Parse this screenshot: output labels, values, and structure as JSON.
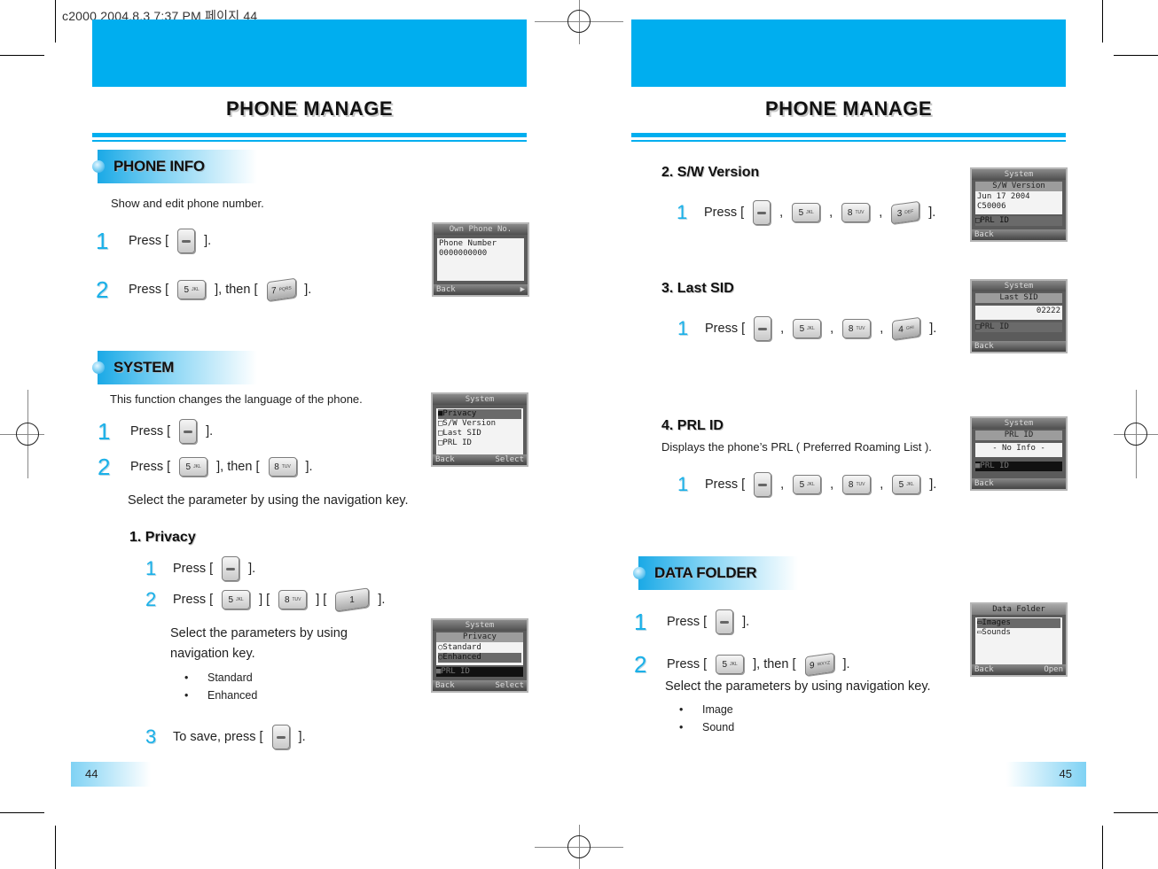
{
  "slug": "c2000  2004.8.3 7:37 PM 페이지 44",
  "colors": {
    "accent": "#00aeef",
    "step_number": "#1ab0e8"
  },
  "left_page": {
    "title": "PHONE MANAGE",
    "page_number": "44",
    "phone_info": {
      "heading": "PHONE INFO",
      "description": "Show and edit phone number.",
      "steps": [
        {
          "num": "1",
          "before": "Press [",
          "after": "]."
        },
        {
          "num": "2",
          "before": "Press [",
          "mid": "], then [",
          "after": "]."
        }
      ],
      "keys": {
        "k5": "5",
        "k5sub": "JKL",
        "k7": "7",
        "k7sub": "PQRS"
      },
      "screen": {
        "title": "Own Phone No.",
        "row1": "Phone Number",
        "row2": "0000000000",
        "left": "Back",
        "right": "▶"
      }
    },
    "system": {
      "heading": "SYSTEM",
      "description": "This function changes the language of the phone.",
      "steps": [
        {
          "num": "1",
          "before": "Press [",
          "after": "]."
        },
        {
          "num": "2",
          "before": "Press [",
          "mid": "], then [",
          "after": "]."
        }
      ],
      "keys": {
        "k5": "5",
        "k5sub": "JKL",
        "k8": "8",
        "k8sub": "TUV"
      },
      "instruction": "Select the parameter by using the navigation key.",
      "screen": {
        "title": "System",
        "items": [
          "Privacy",
          "S/W Version",
          "Last SID",
          "PRL ID"
        ],
        "left": "Back",
        "right": "Select"
      }
    },
    "privacy": {
      "heading": "1. Privacy",
      "steps": [
        {
          "num": "1",
          "before": "Press [",
          "after": "]."
        },
        {
          "num": "2",
          "before": "Press [",
          "sep1": "] [",
          "sep2": "] [",
          "after": "]."
        },
        {
          "num": "3",
          "before": "To save, press [",
          "after": "]."
        }
      ],
      "keys": {
        "k5": "5",
        "k5sub": "JKL",
        "k8": "8",
        "k8sub": "TUV",
        "k1": "1"
      },
      "instruction_line1": "Select the parameters by using",
      "instruction_line2": "navigation key.",
      "options": [
        "Standard",
        "Enhanced"
      ],
      "screen": {
        "title": "System",
        "sub": "Privacy",
        "items": [
          "Standard",
          "Enhanced"
        ],
        "bottom_item": "PRL ID",
        "left": "Back",
        "right": "Select"
      }
    }
  },
  "right_page": {
    "title": "PHONE MANAGE",
    "page_number": "45",
    "sw_version": {
      "heading": "2. S/W Version",
      "step": {
        "num": "1",
        "before": "Press [",
        "sep": ",",
        "after": "]."
      },
      "keys": [
        "5",
        "8",
        "3"
      ],
      "key_subs": [
        "JKL",
        "TUV",
        "DEF"
      ],
      "screen": {
        "title": "System",
        "sub": "S/W Version",
        "row1": "Jun 17 2004",
        "row2": "C50006",
        "bottom_item": "PRL ID",
        "left": "Back"
      }
    },
    "last_sid": {
      "heading": "3. Last SID",
      "step": {
        "num": "1",
        "before": "Press [",
        "sep": ",",
        "after": "]."
      },
      "keys": [
        "5",
        "8",
        "4"
      ],
      "key_subs": [
        "JKL",
        "TUV",
        "GHI"
      ],
      "screen": {
        "title": "System",
        "sub": "Last SID",
        "value": "02222",
        "bottom_item": "PRL ID",
        "left": "Back"
      }
    },
    "prl_id": {
      "heading": "4. PRL ID",
      "description": "Displays the phone’s PRL ( Preferred Roaming List ).",
      "step": {
        "num": "1",
        "before": "Press [",
        "sep": ",",
        "after": "]."
      },
      "keys": [
        "5",
        "8",
        "5"
      ],
      "key_subs": [
        "JKL",
        "TUV",
        "JKL"
      ],
      "screen": {
        "title": "System",
        "sub": "PRL ID",
        "value": "- No Info -",
        "bottom_item": "PRL ID",
        "left": "Back"
      }
    },
    "data_folder": {
      "heading": "DATA FOLDER",
      "steps": [
        {
          "num": "1",
          "before": "Press [",
          "after": "]."
        },
        {
          "num": "2",
          "before": "Press [",
          "mid": "], then [",
          "after": "]."
        }
      ],
      "keys": {
        "k5": "5",
        "k5sub": "JKL",
        "k9": "9",
        "k9sub": "WXYZ"
      },
      "instruction": "Select the parameters by using navigation key.",
      "options": [
        "Image",
        "Sound"
      ],
      "screen": {
        "title": "Data Folder",
        "items": [
          "Images",
          "Sounds"
        ],
        "left": "Back",
        "right": "Open"
      }
    }
  }
}
